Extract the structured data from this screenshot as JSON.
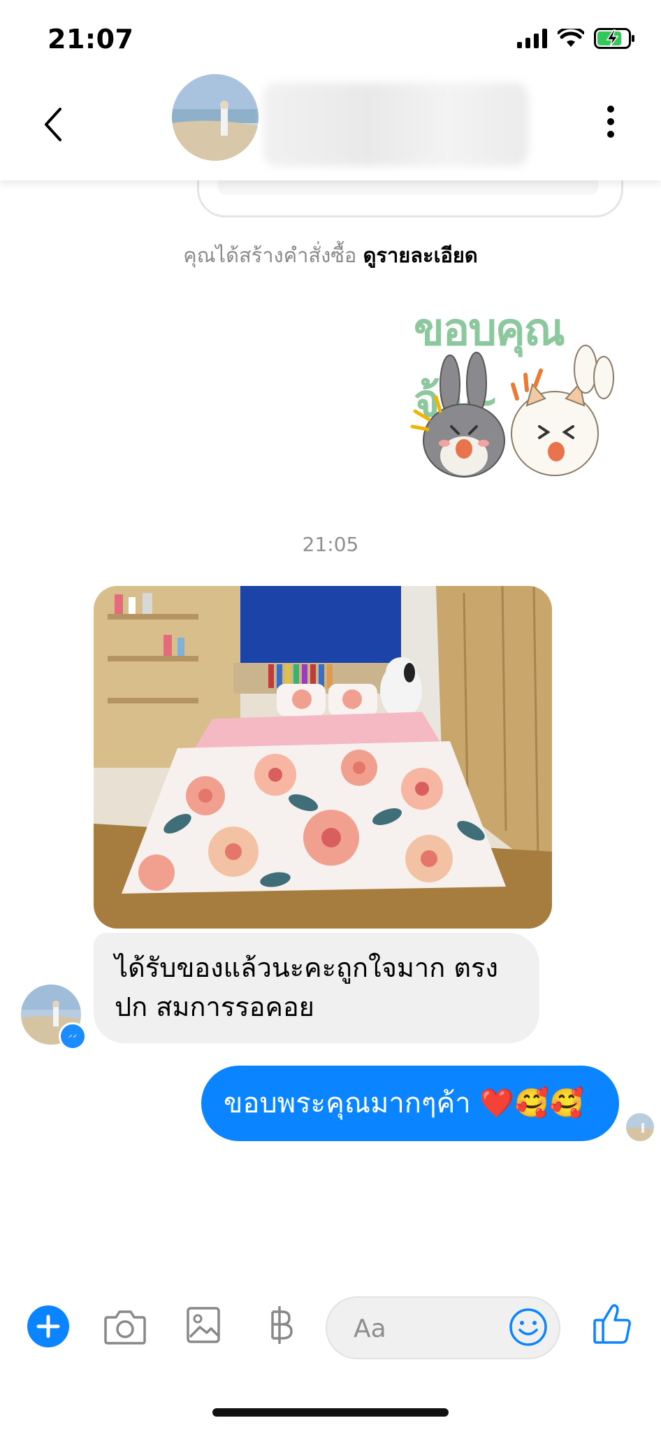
{
  "status_bar": {
    "time": "21:07"
  },
  "nav": {
    "back_icon": "chevron-left-icon",
    "more_icon": "more-vertical-icon"
  },
  "order_note": {
    "text": "คุณได้สร้างคำสั่งซื้อ",
    "link": "ดูรายละเอียด"
  },
  "sticker": {
    "caption": "ขอบคุณจ้า~"
  },
  "timestamp": "21:05",
  "received_message": {
    "text": "ได้รับของแล้วนะคะถูกใจมาก ตรงปก สมการรอคอย"
  },
  "sent_message": {
    "text": "ขอบพระคุณมากๆค้า ❤️🥰🥰"
  },
  "composer": {
    "placeholder": "Aa",
    "icons": [
      "plus-icon",
      "camera-icon",
      "gallery-icon",
      "baht-icon",
      "emoji-icon",
      "thumbs-up-icon"
    ]
  },
  "colors": {
    "accent": "#0a84ff",
    "received_bubble": "#f0f0f0",
    "sticker_text": "#8cc79d"
  }
}
